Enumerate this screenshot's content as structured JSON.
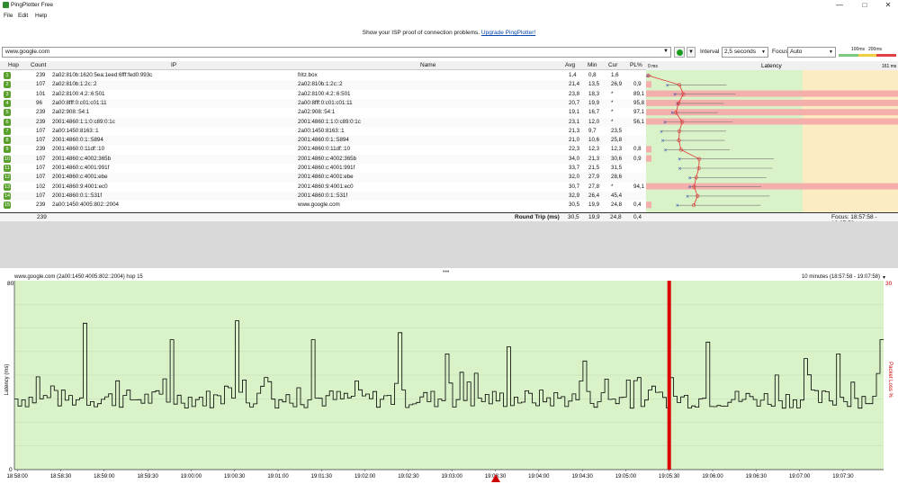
{
  "window": {
    "title": "PingPlotter Free",
    "minimize": "—",
    "maximize": "□",
    "close": "✕"
  },
  "menu": [
    "File",
    "Edit",
    "Help"
  ],
  "promo": {
    "text": "Show your ISP proof of connection problems.",
    "link": "Upgrade PingPlotter!"
  },
  "toolbar": {
    "target": "www.google.com",
    "interval_label": "Interval",
    "interval_value": "2,5 seconds",
    "focus_label": "Focus",
    "focus_value": "Auto",
    "legend": [
      "100ms",
      "200ms"
    ]
  },
  "columns": {
    "hop": "Hop",
    "count": "Count",
    "ip": "IP",
    "name": "Name",
    "avg": "Avg",
    "min": "Min",
    "cur": "Cur",
    "pl": "PL%",
    "latency": "Latency",
    "lat_min": "0 ms",
    "lat_max": "161 ms"
  },
  "hops": [
    {
      "hop": "1",
      "count": "239",
      "ip": "2a02:810b:1620:5ea:1eed:6fff:fed0:993c",
      "name": "fritz.box",
      "avg": "1,4",
      "min": "0,8",
      "cur": "1,6",
      "pl": ""
    },
    {
      "hop": "2",
      "count": "107",
      "ip": "2a02:810b:1:2c::2",
      "name": "2a02:810b:1:2c::2",
      "avg": "21,4",
      "min": "13,5",
      "cur": "26,9",
      "pl": "0,9"
    },
    {
      "hop": "3",
      "count": "101",
      "ip": "2a02:8100:4:2::6:501",
      "name": "2a02:8100:4:2::6:501",
      "avg": "23,8",
      "min": "18,3",
      "cur": "*",
      "pl": "89,1"
    },
    {
      "hop": "4",
      "count": "96",
      "ip": "2a00:8fff:0:c01:c01:11",
      "name": "2a00:8fff:0:c01:c01:11",
      "avg": "20,7",
      "min": "19,9",
      "cur": "*",
      "pl": "95,8"
    },
    {
      "hop": "5",
      "count": "239",
      "ip": "2a02:908::54:1",
      "name": "2a02:908::54:1",
      "avg": "19,1",
      "min": "16,7",
      "cur": "*",
      "pl": "97,1"
    },
    {
      "hop": "6",
      "count": "239",
      "ip": "2001:4860:1:1:0:c89:0:1c",
      "name": "2001:4860:1:1:0:c89:0:1c",
      "avg": "23,1",
      "min": "12,0",
      "cur": "*",
      "pl": "56,1"
    },
    {
      "hop": "7",
      "count": "107",
      "ip": "2a00:1450:8163::1",
      "name": "2a00:1450:8163::1",
      "avg": "21,3",
      "min": "9,7",
      "cur": "23,5",
      "pl": ""
    },
    {
      "hop": "8",
      "count": "107",
      "ip": "2001:4860:0:1::5894",
      "name": "2001:4860:0:1::5894",
      "avg": "21,0",
      "min": "10,6",
      "cur": "25,8",
      "pl": ""
    },
    {
      "hop": "9",
      "count": "239",
      "ip": "2001:4860:0:11df::10",
      "name": "2001:4860:0:11df::10",
      "avg": "22,3",
      "min": "12,3",
      "cur": "12,3",
      "pl": "0,8"
    },
    {
      "hop": "10",
      "count": "107",
      "ip": "2001:4860:c:4002:365b",
      "name": "2001:4860:c:4002:365b",
      "avg": "34,0",
      "min": "21,3",
      "cur": "30,6",
      "pl": "0,9"
    },
    {
      "hop": "11",
      "count": "107",
      "ip": "2001:4860:c:4001:991f",
      "name": "2001:4860:c:4001:991f",
      "avg": "33,7",
      "min": "21,5",
      "cur": "31,5",
      "pl": ""
    },
    {
      "hop": "12",
      "count": "107",
      "ip": "2001:4860:c:4001:ebe",
      "name": "2001:4860:c:4001:ebe",
      "avg": "32,0",
      "min": "27,9",
      "cur": "28,6",
      "pl": ""
    },
    {
      "hop": "13",
      "count": "102",
      "ip": "2001:4860:9:4001:ec0",
      "name": "2001:4860:9:4001:ec0",
      "avg": "30,7",
      "min": "27,8",
      "cur": "*",
      "pl": "94,1"
    },
    {
      "hop": "14",
      "count": "107",
      "ip": "2001:4860:0:1::531f",
      "name": "2001:4860:0:1::531f",
      "avg": "32,9",
      "min": "26,4",
      "cur": "45,4",
      "pl": ""
    },
    {
      "hop": "15",
      "count": "239",
      "ip": "2a00:1450:4005:802::2004",
      "name": "www.google.com",
      "avg": "30,5",
      "min": "19,9",
      "cur": "24,8",
      "pl": "0,4"
    }
  ],
  "totals": {
    "count": "239",
    "label": "Round Trip (ms)",
    "avg": "30,5",
    "min": "19,9",
    "cur": "24,8",
    "pl": "0,4",
    "focus": "Focus: 18:57:58 - 19:07:58"
  },
  "timeline": {
    "title": "www.google.com (2a00:1450:4005:802::2004) hop 15",
    "range": "10 minutes (18:57:58 - 19:07:58)",
    "y_max": "80",
    "y_min": "0",
    "pl_max": "30",
    "ylabel": "Latency (ms)",
    "ylabel_right": "Packet Loss %",
    "xticks": [
      "18:58:00",
      "18:58:30",
      "18:59:00",
      "18:59:30",
      "19:00:00",
      "19:00:30",
      "19:01:00",
      "19:01:30",
      "19:02:00",
      "19:02:30",
      "19:03:00",
      "19:03:30",
      "19:04:00",
      "19:04:30",
      "19:05:00",
      "19:05:30",
      "19:06:00",
      "19:06:30",
      "19:07:00",
      "19:07:30"
    ]
  },
  "chart_data": {
    "type": "line",
    "title": "www.google.com (2a00:1450:4005:802::2004) hop 15",
    "xlabel": "",
    "ylabel": "Latency (ms)",
    "ylim": [
      0,
      80
    ],
    "x_range": [
      "18:57:58",
      "19:07:58"
    ],
    "spike_times_s": [
      47,
      108,
      152,
      205,
      265,
      298,
      340,
      393,
      478,
      545,
      568,
      598,
      672,
      728,
      782,
      837,
      918,
      982
    ],
    "spike_values": [
      62,
      55,
      63,
      55,
      58,
      49,
      52,
      46,
      54,
      47,
      49,
      55,
      53,
      63,
      58,
      58,
      49,
      56
    ],
    "baseline_ms": 30,
    "loss_marker_time": "19:05:30",
    "colors": {
      "background": "#d9f2c8",
      "loss": "#dd0000",
      "line": "#000000"
    }
  }
}
